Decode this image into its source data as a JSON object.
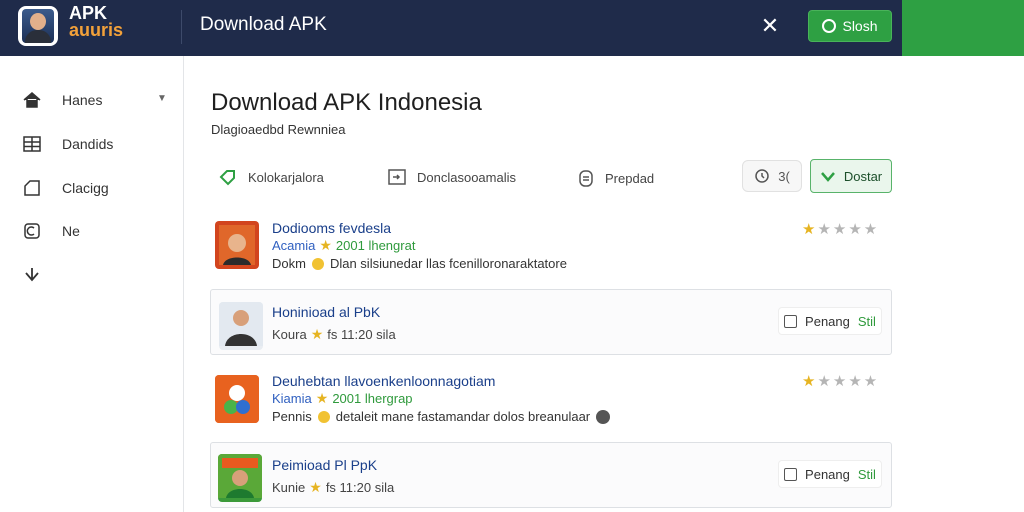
{
  "header": {
    "logo_line1": "APK",
    "logo_line2": "auuris",
    "title": "Download APK",
    "close_icon": "close-icon",
    "button_label": "Slosh"
  },
  "sidebar": {
    "items": [
      {
        "label": "Hanes",
        "icon": "home-icon"
      },
      {
        "label": "Dandids",
        "icon": "grid-icon"
      },
      {
        "label": "Clacigg",
        "icon": "folder-icon"
      },
      {
        "label": "Ne",
        "icon": "refresh-icon"
      },
      {
        "label": "",
        "icon": "download-icon"
      }
    ]
  },
  "main": {
    "title": "Download APK Indonesia",
    "subtitle": "Dlagioaedbd Rewnniea",
    "filters": [
      {
        "label": "Kolokarjalora",
        "icon": "tag-icon"
      },
      {
        "label": "Donclasooamalis",
        "icon": "login-icon"
      },
      {
        "label": "Prepdad",
        "icon": "clipboard-icon"
      }
    ],
    "chip_grey_label": "3(",
    "chip_green_label": "Dostar"
  },
  "apps": [
    {
      "name": "Dodiooms fevdesla",
      "author": "Acamia",
      "rating_text": "2001 lhengrat",
      "desc": "Dlan silsiunedar llas fcenilloronaraktatore",
      "desc_prefix": "Dokm",
      "stars": 1
    },
    {
      "name": "Honinioad al PbK",
      "author": "Koura",
      "rating_text": "fs 11:20 sila",
      "action_label": "Penang",
      "action_green": "Stil"
    },
    {
      "name": "Deuhebtan llavoenkenloonnagotiam",
      "author": "Kiamia",
      "rating_text": "2001 lhergrap",
      "desc": "detaleit mane fastamandar dolos breanulaar",
      "desc_prefix": "Pennis",
      "stars": 1
    },
    {
      "name": "Peimioad Pl PpK",
      "author": "Kunie",
      "rating_text": "fs 11:20 sila",
      "action_label": "Penang",
      "action_green": "Stil"
    }
  ],
  "colors": {
    "header_bg": "#1f2b4a",
    "accent_green": "#2ea043",
    "link_blue": "#1a3f8a",
    "star": "#e6b422"
  }
}
